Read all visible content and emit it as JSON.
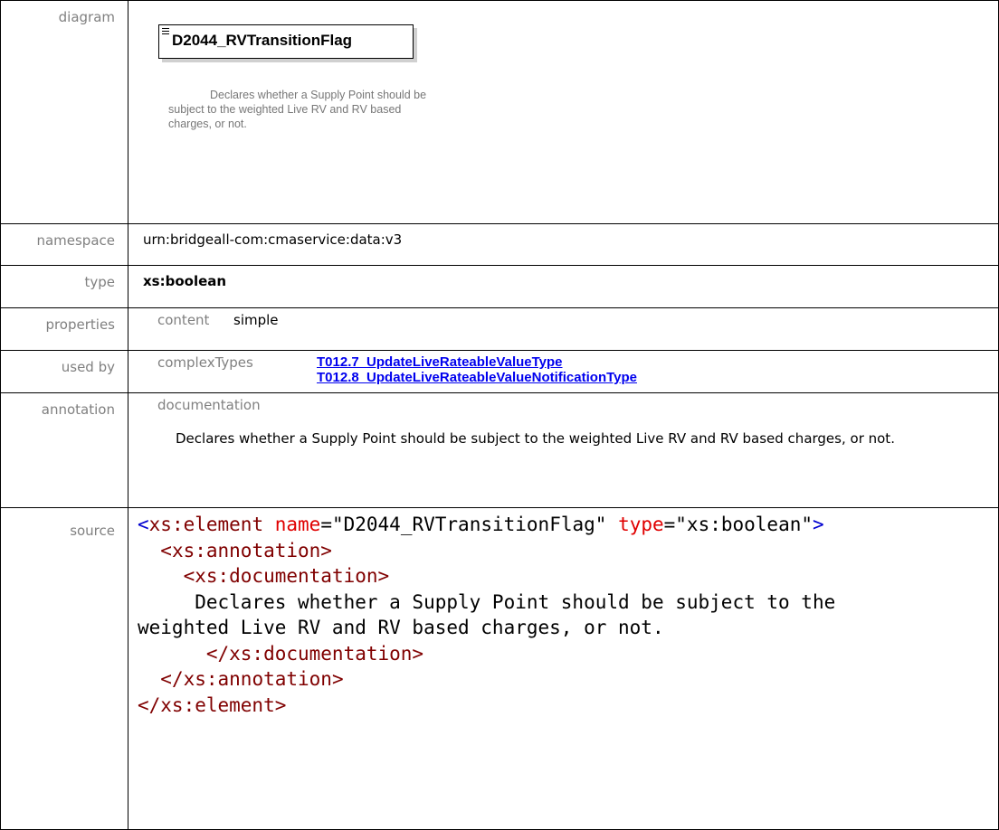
{
  "rows": {
    "diagram": {
      "label": "diagram",
      "element_name": "D2044_RVTransitionFlag",
      "doc": "Declares whether a Supply Point should be subject to the weighted Live RV and RV based charges, or not."
    },
    "namespace": {
      "label": "namespace",
      "value": "urn:bridgeall-com:cmaservice:data:v3"
    },
    "type": {
      "label": "type",
      "value": "xs:boolean"
    },
    "properties": {
      "label": "properties",
      "key": "content",
      "value": "simple"
    },
    "used_by": {
      "label": "used by",
      "key": "complexTypes",
      "links": [
        "T012.7_UpdateLiveRateableValueType",
        "T012.8_UpdateLiveRateableValueNotificationType"
      ]
    },
    "annotation": {
      "label": "annotation",
      "key": "documentation",
      "text": "Declares whether a Supply Point should be subject to the weighted Live RV and RV based charges, or not."
    },
    "source": {
      "label": "source",
      "line1_open": "<",
      "line1_tag": "xs:element",
      "line1_attr1": "name",
      "line1_val1": "=\"D2044_RVTransitionFlag\"",
      "line1_attr2": "type",
      "line1_val2": "=\"xs:boolean\"",
      "line1_close": ">",
      "line2": "<xs:annotation>",
      "line3": "<xs:documentation>",
      "line4": "     Declares whether a Supply Point should be subject to the",
      "line5": "weighted Live RV and RV based charges, or not.",
      "line6": "</xs:documentation>",
      "line7": "</xs:annotation>",
      "line8": "</xs:element>"
    }
  }
}
